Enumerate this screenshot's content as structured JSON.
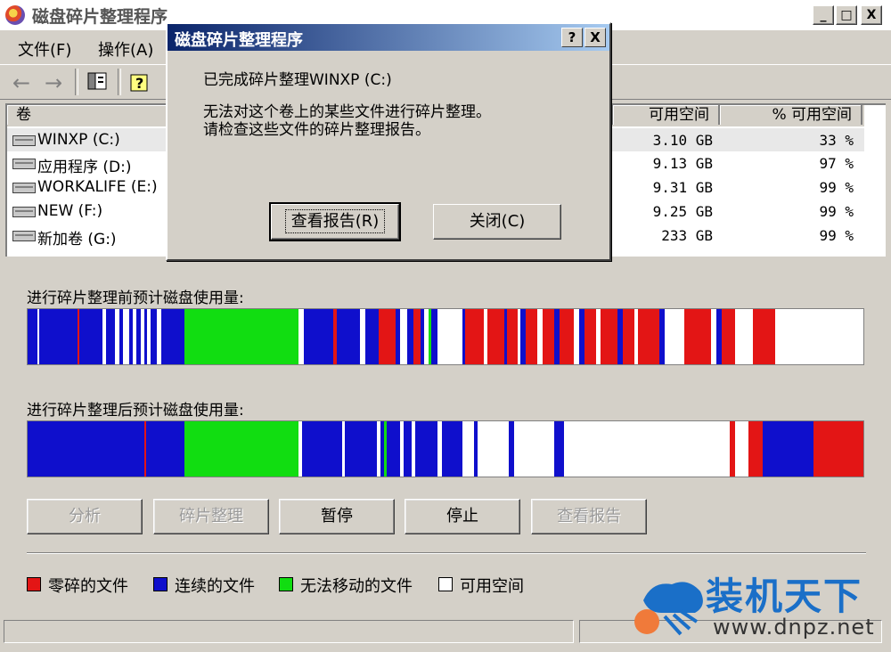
{
  "window": {
    "title": "磁盘碎片整理程序",
    "min_glyph": "_",
    "max_glyph": "□",
    "close_glyph": "X"
  },
  "menu": [
    {
      "label": "文件(F)"
    },
    {
      "label": "操作(A)"
    }
  ],
  "toolbar": {
    "back_glyph": "←",
    "forward_glyph": "→"
  },
  "list": {
    "columns": {
      "volume": "卷",
      "free_space": "可用空间",
      "pct_free": "% 可用空间"
    },
    "rows": [
      {
        "name": "WINXP (C:)",
        "free": "3.10 GB",
        "pct": "33 %"
      },
      {
        "name": "应用程序 (D:)",
        "free": "9.13 GB",
        "pct": "97 %"
      },
      {
        "name": "WORKALIFE (E:)",
        "free": "9.31 GB",
        "pct": "99 %"
      },
      {
        "name": "NEW (F:)",
        "free": "9.25 GB",
        "pct": "99 %"
      },
      {
        "name": "新加卷 (G:)",
        "free": "233 GB",
        "pct": "99 %"
      }
    ]
  },
  "usage": {
    "before_label": "进行碎片整理前预计磁盘使用量:",
    "after_label": "进行碎片整理后预计磁盘使用量:",
    "colors": {
      "fragmented": "#e31515",
      "contiguous": "#0f0fcc",
      "unmovable": "#11dd11",
      "free": "#ffffff"
    },
    "before_segments": [
      [
        "contiguous",
        0,
        1.2
      ],
      [
        "free",
        1.2,
        1.4
      ],
      [
        "contiguous",
        1.4,
        6
      ],
      [
        "fragmented",
        6,
        6.2
      ],
      [
        "contiguous",
        6.2,
        9
      ],
      [
        "free",
        9,
        9.4
      ],
      [
        "contiguous",
        9.4,
        10.4
      ],
      [
        "free",
        10.4,
        11
      ],
      [
        "contiguous",
        11,
        11.4
      ],
      [
        "free",
        11.4,
        12.2
      ],
      [
        "contiguous",
        12.2,
        12.6
      ],
      [
        "free",
        12.6,
        13
      ],
      [
        "contiguous",
        13,
        13.5
      ],
      [
        "free",
        13.5,
        14
      ],
      [
        "contiguous",
        14,
        14.3
      ],
      [
        "free",
        14.3,
        14.7
      ],
      [
        "contiguous",
        14.7,
        15.5
      ],
      [
        "free",
        15.5,
        16
      ],
      [
        "contiguous",
        16,
        18.8
      ],
      [
        "unmovable",
        18.8,
        32.4
      ],
      [
        "free",
        32.4,
        33
      ],
      [
        "contiguous",
        33,
        36.6
      ],
      [
        "fragmented",
        36.6,
        37
      ],
      [
        "contiguous",
        37,
        39.8
      ],
      [
        "free",
        39.8,
        40.4
      ],
      [
        "contiguous",
        40.4,
        42
      ],
      [
        "fragmented",
        42,
        44
      ],
      [
        "contiguous",
        44,
        44.6
      ],
      [
        "free",
        44.6,
        45.4
      ],
      [
        "contiguous",
        45.4,
        46.2
      ],
      [
        "fragmented",
        46.2,
        47
      ],
      [
        "contiguous",
        47,
        47.4
      ],
      [
        "free",
        47.4,
        48
      ],
      [
        "unmovable",
        48,
        48.3
      ],
      [
        "contiguous",
        48.3,
        49
      ],
      [
        "free",
        49,
        52
      ],
      [
        "contiguous",
        52,
        52.3
      ],
      [
        "fragmented",
        52.3,
        54.6
      ],
      [
        "free",
        54.6,
        55
      ],
      [
        "fragmented",
        55,
        57
      ],
      [
        "contiguous",
        57,
        57.4
      ],
      [
        "fragmented",
        57.4,
        58.6
      ],
      [
        "free",
        58.6,
        59
      ],
      [
        "contiguous",
        59,
        59.6
      ],
      [
        "fragmented",
        59.6,
        61
      ],
      [
        "free",
        61,
        61.6
      ],
      [
        "fragmented",
        61.6,
        63
      ],
      [
        "contiguous",
        63,
        63.6
      ],
      [
        "fragmented",
        63.6,
        65.4
      ],
      [
        "free",
        65.4,
        66
      ],
      [
        "contiguous",
        66,
        66.6
      ],
      [
        "fragmented",
        66.6,
        68
      ],
      [
        "free",
        68,
        68.6
      ],
      [
        "fragmented",
        68.6,
        70.6
      ],
      [
        "contiguous",
        70.6,
        71.2
      ],
      [
        "fragmented",
        71.2,
        72.6
      ],
      [
        "free",
        72.6,
        73
      ],
      [
        "fragmented",
        73,
        75.6
      ],
      [
        "contiguous",
        75.6,
        76.2
      ],
      [
        "free",
        76.2,
        78.6
      ],
      [
        "fragmented",
        78.6,
        81.8
      ],
      [
        "free",
        81.8,
        82.4
      ],
      [
        "contiguous",
        82.4,
        83
      ],
      [
        "fragmented",
        83,
        84.6
      ],
      [
        "free",
        84.6,
        86.8
      ],
      [
        "fragmented",
        86.8,
        89.4
      ],
      [
        "free",
        89.4,
        100
      ]
    ],
    "after_segments": [
      [
        "contiguous",
        0,
        14
      ],
      [
        "fragmented",
        14,
        14.2
      ],
      [
        "contiguous",
        14.2,
        18.8
      ],
      [
        "unmovable",
        18.8,
        32.4
      ],
      [
        "free",
        32.4,
        32.8
      ],
      [
        "contiguous",
        32.8,
        37.6
      ],
      [
        "free",
        37.6,
        38
      ],
      [
        "contiguous",
        38,
        41.8
      ],
      [
        "free",
        41.8,
        42.2
      ],
      [
        "contiguous",
        42.2,
        42.6
      ],
      [
        "unmovable",
        42.6,
        43
      ],
      [
        "contiguous",
        43,
        44.6
      ],
      [
        "free",
        44.6,
        45
      ],
      [
        "contiguous",
        45,
        46
      ],
      [
        "free",
        46,
        46.4
      ],
      [
        "contiguous",
        46.4,
        49
      ],
      [
        "free",
        49,
        49.6
      ],
      [
        "contiguous",
        49.6,
        52
      ],
      [
        "free",
        52,
        53.4
      ],
      [
        "contiguous",
        53.4,
        53.8
      ],
      [
        "free",
        53.8,
        57.6
      ],
      [
        "contiguous",
        57.6,
        58.2
      ],
      [
        "free",
        58.2,
        63
      ],
      [
        "contiguous",
        63,
        64.2
      ],
      [
        "free",
        64.2,
        84
      ],
      [
        "fragmented",
        84,
        84.6
      ],
      [
        "free",
        84.6,
        86.2
      ],
      [
        "fragmented",
        86.2,
        88
      ],
      [
        "contiguous",
        88,
        94
      ],
      [
        "fragmented",
        94,
        100
      ]
    ]
  },
  "buttons": {
    "analyze": "分析",
    "defragment": "碎片整理",
    "pause": "暂停",
    "stop": "停止",
    "view_report": "查看报告"
  },
  "legend": {
    "fragmented": "零碎的文件",
    "contiguous": "连续的文件",
    "unmovable": "无法移动的文件",
    "free": "可用空间"
  },
  "dialog": {
    "title": "磁盘碎片整理程序",
    "help_glyph": "?",
    "close_glyph": "X",
    "line1": "已完成碎片整理WINXP (C:)",
    "line2": "无法对这个卷上的某些文件进行碎片整理。",
    "line3": "请检查这些文件的碎片整理报告。",
    "view_report_button": "查看报告(R)",
    "close_button": "关闭(C)"
  },
  "watermark": {
    "brand": "装机天下",
    "url": "www.dnpz.net"
  }
}
